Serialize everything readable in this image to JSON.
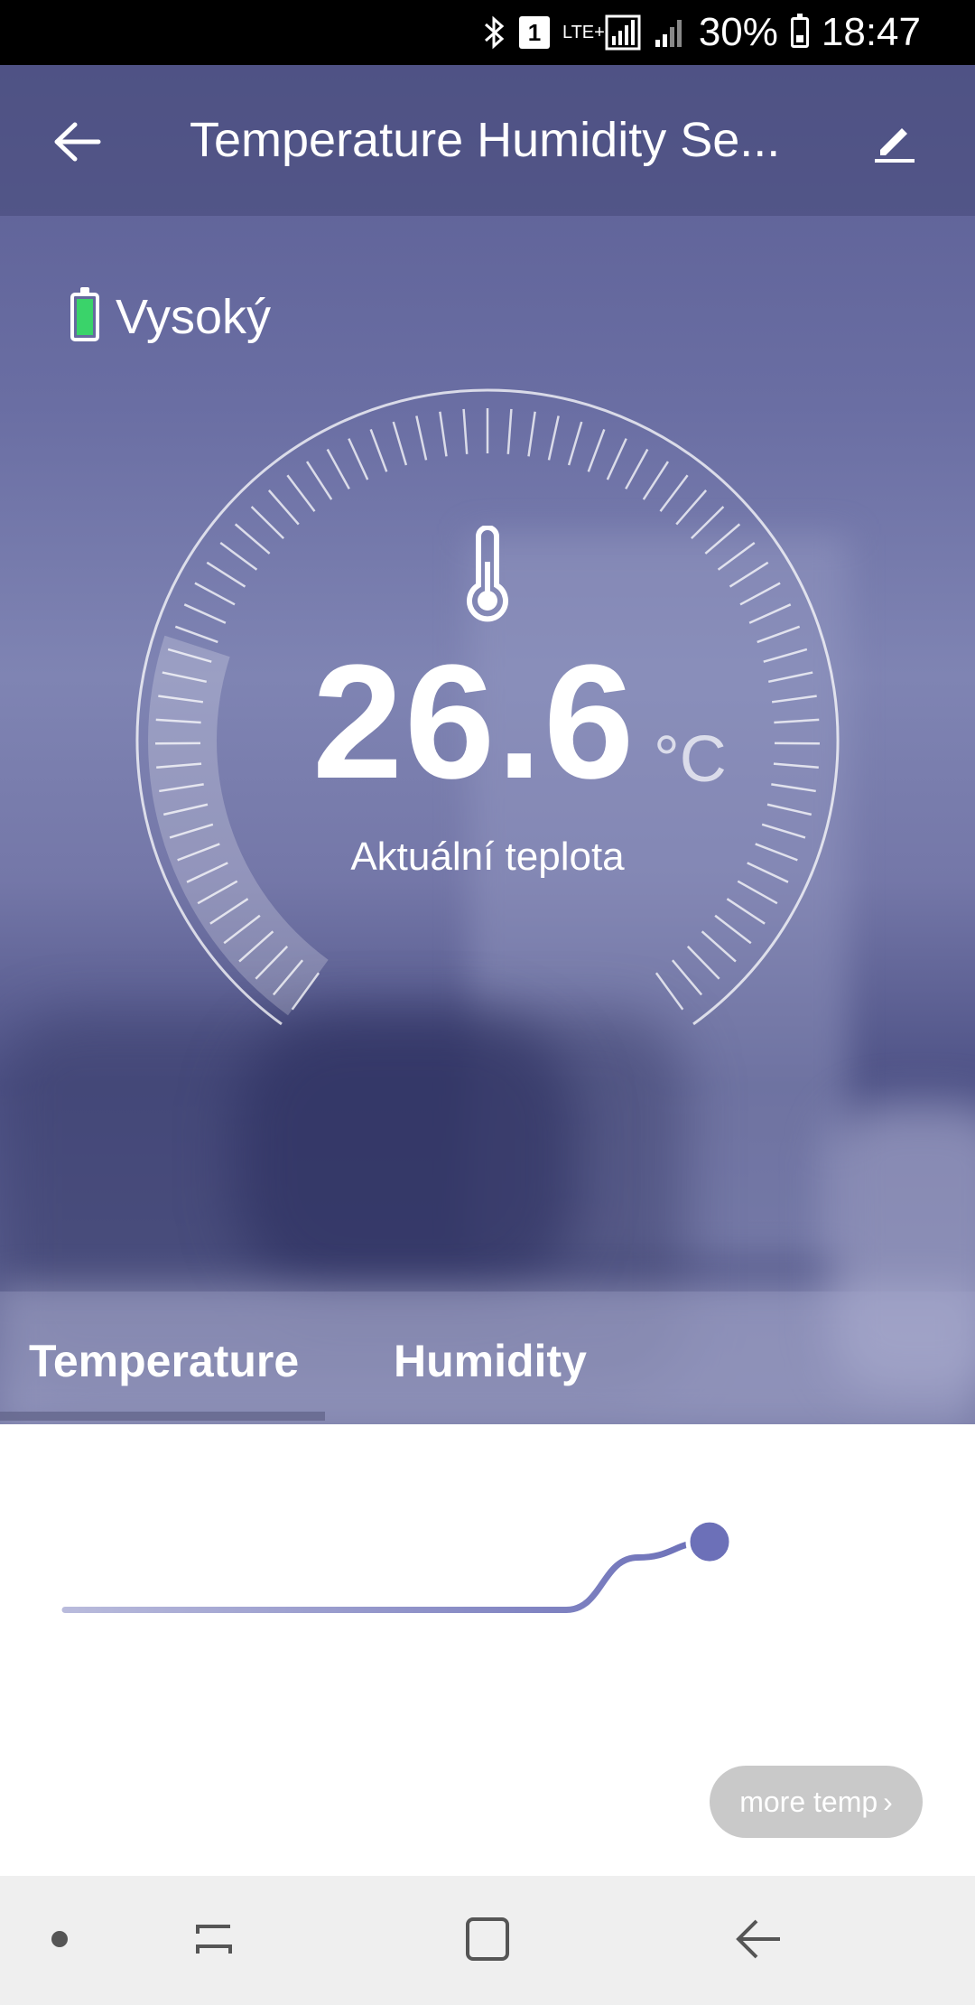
{
  "status_bar": {
    "battery_percent": "30%",
    "time": "18:47",
    "sim_label": "1",
    "network_label": "LTE+"
  },
  "header": {
    "title": "Temperature Humidity Se...",
    "back_icon": "arrow-left-icon",
    "edit_icon": "pencil-icon"
  },
  "battery": {
    "label": "Vysoký",
    "level": "high",
    "color": "#3ad36a"
  },
  "gauge": {
    "value": "26.6",
    "unit": "°C",
    "caption": "Aktuální teplota"
  },
  "tabs": [
    {
      "label": "Temperature",
      "selected": true
    },
    {
      "label": "Humidity",
      "selected": false
    }
  ],
  "chart": {
    "more_label": "more temp",
    "accent": "#6c70b8"
  },
  "chart_data": {
    "type": "line",
    "title": "",
    "xlabel": "",
    "ylabel": "",
    "series": [
      {
        "values": [
          24.0,
          24.0,
          24.0,
          24.0,
          24.0,
          24.0,
          24.0,
          24.0,
          26.0,
          26.6
        ]
      }
    ]
  },
  "navbar": {
    "items": [
      "dot-icon",
      "recents-icon",
      "home-icon",
      "back-icon"
    ]
  }
}
